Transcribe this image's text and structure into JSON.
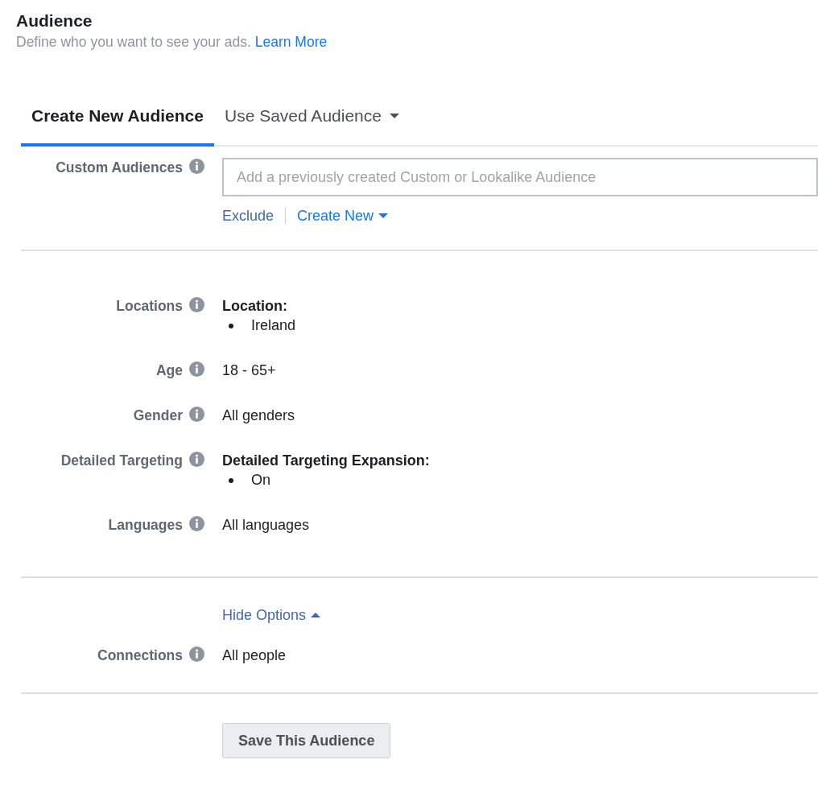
{
  "header": {
    "title": "Audience",
    "subtitle": "Define who you want to see your ads.",
    "link": "Learn More"
  },
  "tabs": [
    {
      "label": "Create New Audience",
      "selected": true,
      "dropdown": false
    },
    {
      "label": "Use Saved Audience",
      "selected": false,
      "dropdown": true
    }
  ],
  "custom_audiences": {
    "label": "Custom Audiences",
    "placeholder": "Add a previously created Custom or Lookalike Audience",
    "actions": [
      {
        "label": "Exclude",
        "dropdown": false
      },
      {
        "label": "Create New",
        "dropdown": true
      }
    ]
  },
  "settings": [
    {
      "label": "Locations",
      "kind": "list",
      "heading": "Location:",
      "items": [
        "Ireland"
      ]
    },
    {
      "label": "Age",
      "kind": "text",
      "value": "18 - 65+"
    },
    {
      "label": "Gender",
      "kind": "text",
      "value": "All genders"
    },
    {
      "label": "Detailed Targeting",
      "kind": "list",
      "heading": "Detailed Targeting Expansion:",
      "items": [
        "On"
      ]
    },
    {
      "label": "Languages",
      "kind": "text",
      "value": "All languages"
    }
  ],
  "options_toggle": {
    "label": "Hide Options",
    "expanded": true
  },
  "connections": {
    "label": "Connections",
    "value": "All people"
  },
  "save_button": "Save This Audience"
}
